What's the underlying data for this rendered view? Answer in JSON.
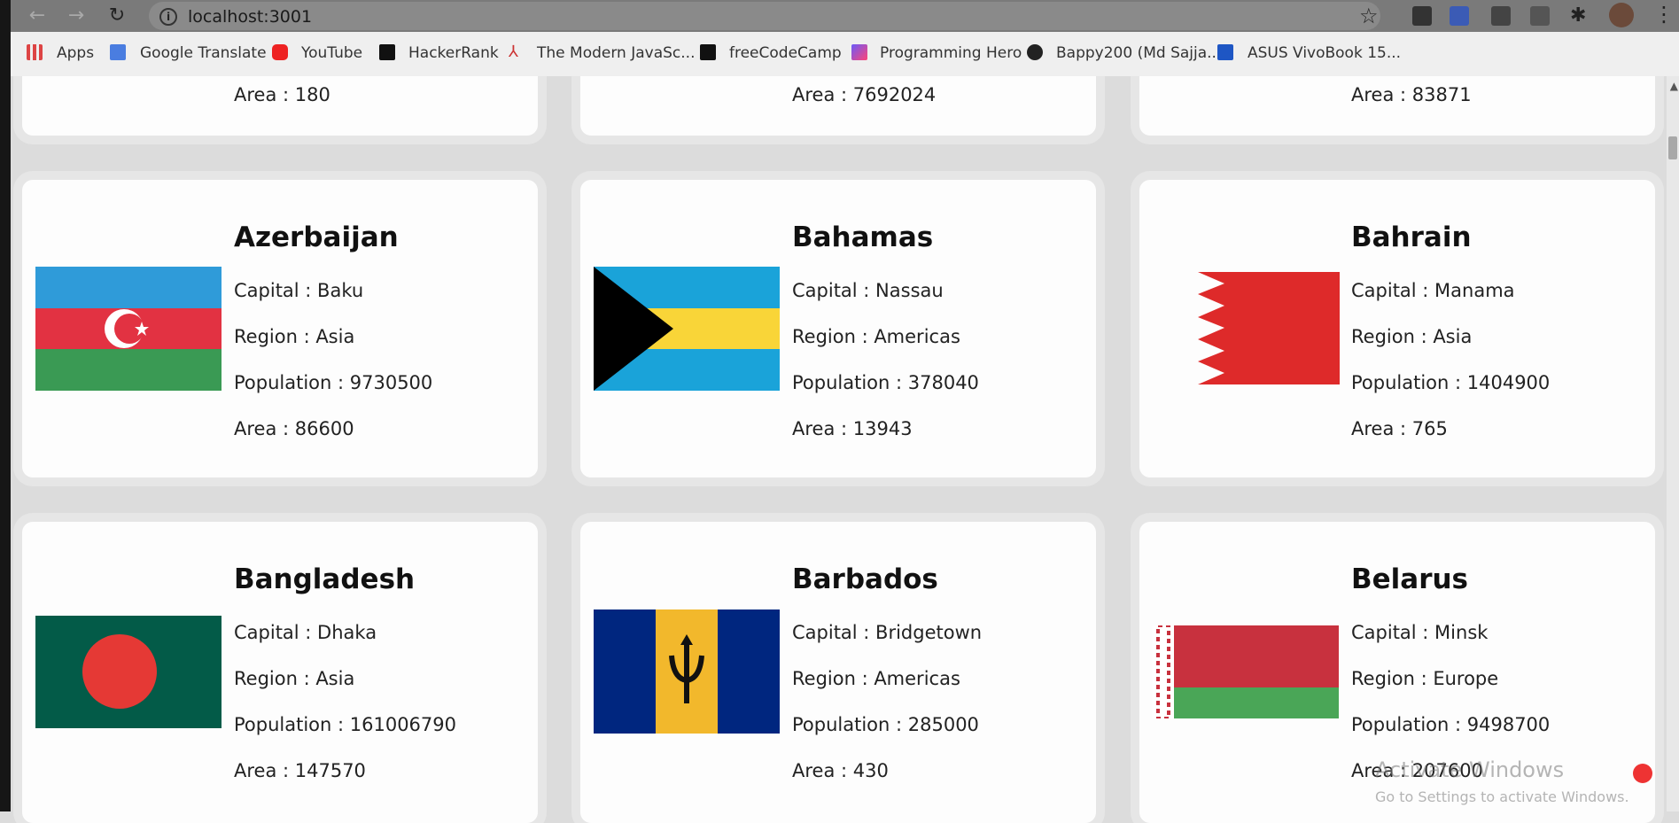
{
  "browser": {
    "url": "localhost:3001",
    "bookmarks": [
      "Apps",
      "Google Translate",
      "YouTube",
      "HackerRank",
      "The Modern JavaSc...",
      "freeCodeCamp",
      "Programming Hero",
      "Bappy200 (Md Sajja...",
      "ASUS VivoBook 15..."
    ]
  },
  "top_row": [
    {
      "area": "Area : 180"
    },
    {
      "area": "Area : 7692024"
    },
    {
      "area": "Area : 83871"
    }
  ],
  "countries": [
    {
      "name": "Azerbaijan",
      "capital": "Capital : Baku",
      "region": "Region : Asia",
      "population": "Population : 9730500",
      "area": "Area : 86600"
    },
    {
      "name": "Bahamas",
      "capital": "Capital : Nassau",
      "region": "Region : Americas",
      "population": "Population : 378040",
      "area": "Area : 13943"
    },
    {
      "name": "Bahrain",
      "capital": "Capital : Manama",
      "region": "Region : Asia",
      "population": "Population : 1404900",
      "area": "Area : 765"
    },
    {
      "name": "Bangladesh",
      "capital": "Capital : Dhaka",
      "region": "Region : Asia",
      "population": "Population : 161006790",
      "area": "Area : 147570"
    },
    {
      "name": "Barbados",
      "capital": "Capital : Bridgetown",
      "region": "Region : Americas",
      "population": "Population : 285000",
      "area": "Area : 430"
    },
    {
      "name": "Belarus",
      "capital": "Capital : Minsk",
      "region": "Region : Europe",
      "population": "Population : 9498700",
      "area": "Area : 207600"
    }
  ],
  "watermark": {
    "line1": "Activate Windows",
    "line2": "Go to Settings to activate Windows."
  }
}
